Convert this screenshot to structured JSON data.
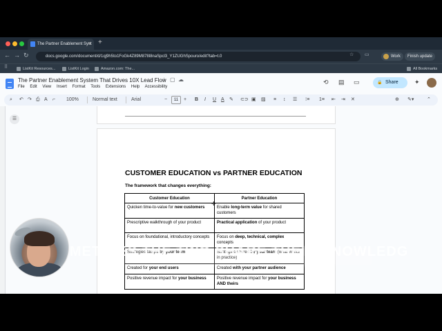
{
  "browser": {
    "tab_title": "The Partner Enablement Syst",
    "url": "docs.google.com/document/d/1qj9h5to1FoGk4Z89M878l8naSpcl3_Y1ZUGhSpouro/edit?tab=t.0",
    "profile_label": "Work",
    "finish_update_label": "Finish update",
    "bookmarks": [
      "ListKit Resources...",
      "ListKit Login",
      "Amazon.com: The..."
    ],
    "all_bookmarks_label": "All Bookmarks"
  },
  "docs": {
    "title": "The Partner Enablement System That Drives 10X Lead Flow",
    "menu": [
      "File",
      "Edit",
      "View",
      "Insert",
      "Format",
      "Tools",
      "Extensions",
      "Help",
      "Accessibility"
    ],
    "share_label": "Share",
    "toolbar": {
      "zoom": "100%",
      "style": "Normal text",
      "font": "Arial",
      "font_size": "11"
    }
  },
  "document": {
    "heading": "CUSTOMER EDUCATION vs PARTNER EDUCATION",
    "subheading": "The framework that changes everything:",
    "table": {
      "headers": [
        "Customer Education",
        "Partner Education"
      ],
      "rows": [
        {
          "c1a": "Quicken time-to-value for ",
          "c1b": "new customers",
          "c2a": "Enable ",
          "c2b": "long-term value",
          "c2c": " for shared customers"
        },
        {
          "c1a": "Prescriptive walkthrough of your product",
          "c1b": "",
          "c2a": "",
          "c2b": "Practical application",
          "c2c": " of your product"
        },
        {
          "c1a": "Focus on foundational, introductory concepts",
          "c1b": "",
          "c2a": "Focus on ",
          "c2b": "deep, technical, complex",
          "c2c": " concepts"
        },
        {
          "c1a": "Strategies taught ",
          "c1b": "by your team",
          "c2a": "Strategies shared ",
          "c2b": "by your team",
          "c2c": " (what works in practice)"
        },
        {
          "c1a": "Created for ",
          "c1b": "your end users",
          "c2a": "Created ",
          "c2b": "with your partner audience",
          "c2c": ""
        },
        {
          "c1a": "Positive revenue impact for ",
          "c1b": "your business",
          "c2a": "Positive revenue impact for ",
          "c2b": "your business AND theirs",
          "c2c": ""
        }
      ]
    }
  },
  "overlay": {
    "caption": "SOMETIMES THE TWO SHARE THEIR KNOWLEDGE"
  }
}
